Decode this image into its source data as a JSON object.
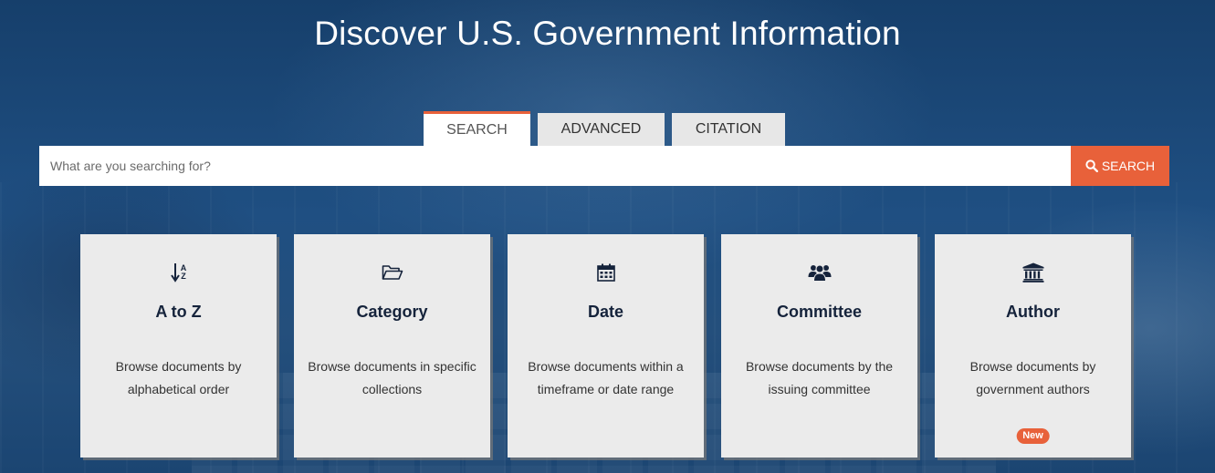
{
  "page": {
    "title": "Discover U.S. Government Information"
  },
  "tabs": [
    {
      "label": "SEARCH",
      "active": true
    },
    {
      "label": "ADVANCED",
      "active": false
    },
    {
      "label": "CITATION",
      "active": false
    }
  ],
  "search": {
    "value": "",
    "placeholder": "What are you searching for?",
    "button_label": "SEARCH",
    "button_icon": "search-icon"
  },
  "cards": [
    {
      "title": "A to Z",
      "icon": "sort-alpha-icon",
      "desc_line1": "Browse documents by",
      "desc_line2": "alphabetical order",
      "az_top": "A",
      "az_bottom": "Z"
    },
    {
      "title": "Category",
      "icon": "folder-open-icon",
      "desc_line1": "Browse documents in specific",
      "desc_line2": "collections"
    },
    {
      "title": "Date",
      "icon": "calendar-icon",
      "desc_line1": "Browse documents within a",
      "desc_line2": "timeframe or date range"
    },
    {
      "title": "Committee",
      "icon": "users-icon",
      "desc_line1": "Browse documents by the",
      "desc_line2": "issuing committee"
    },
    {
      "title": "Author",
      "icon": "institution-icon",
      "desc_line1": "Browse documents by",
      "desc_line2": "government authors",
      "badge": "New"
    }
  ],
  "colors": {
    "accent": "#e8613a",
    "card_background": "#ebebeb",
    "title_text": "#15233b",
    "hero_background": "#1e4a78"
  }
}
